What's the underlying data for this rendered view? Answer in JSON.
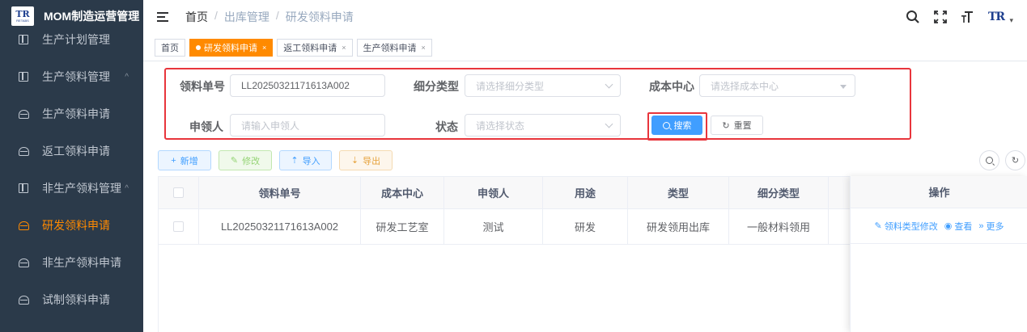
{
  "app": {
    "title": "MOM制造运营管理",
    "logo_text": "TR",
    "logo_sub": "RETABS"
  },
  "sidebar": {
    "items": [
      {
        "label": "生产计划管理",
        "icon": "grid-icon",
        "active": false,
        "expandable": false
      },
      {
        "label": "生产领料管理",
        "icon": "grid-icon",
        "active": false,
        "expandable": true,
        "arrow": "^"
      },
      {
        "label": "生产领料申请",
        "icon": "helmet-icon",
        "active": false,
        "expandable": false
      },
      {
        "label": "返工领料申请",
        "icon": "helmet-icon",
        "active": false,
        "expandable": false
      },
      {
        "label": "非生产领料管理",
        "icon": "grid-icon",
        "active": false,
        "expandable": true,
        "arrow": "^"
      },
      {
        "label": "研发领料申请",
        "icon": "helmet-icon",
        "active": true,
        "expandable": false
      },
      {
        "label": "非生产领料申请",
        "icon": "helmet-icon",
        "active": false,
        "expandable": false
      },
      {
        "label": "试制领料申请",
        "icon": "helmet-icon",
        "active": false,
        "expandable": false
      }
    ]
  },
  "breadcrumb": {
    "home": "首页",
    "level1": "出库管理",
    "current": "研发领料申请",
    "sep": "/"
  },
  "header": {
    "logo_text": "TR"
  },
  "tags": [
    {
      "label": "首页",
      "active": false,
      "closable": false
    },
    {
      "label": "研发领料申请",
      "active": true,
      "closable": true
    },
    {
      "label": "返工领料申请",
      "active": false,
      "closable": true
    },
    {
      "label": "生产领料申请",
      "active": false,
      "closable": true
    }
  ],
  "tag_close": "×",
  "search": {
    "order_no_label": "领料单号",
    "order_no_value": "LL20250321171613A002",
    "subtype_label": "细分类型",
    "subtype_placeholder": "请选择细分类型",
    "cost_center_label": "成本中心",
    "cost_center_placeholder": "请选择成本中心",
    "applicant_label": "申领人",
    "applicant_placeholder": "请输入申领人",
    "status_label": "状态",
    "status_placeholder": "请选择状态",
    "search_btn": "搜索",
    "reset_btn": "重置"
  },
  "toolbar": {
    "add": "新增",
    "edit": "修改",
    "import": "导入",
    "export": "导出"
  },
  "table": {
    "columns": [
      "领料单号",
      "成本中心",
      "申领人",
      "用途",
      "类型",
      "细分类型"
    ],
    "op_header": "操作",
    "rows": [
      {
        "order_no": "LL20250321171613A002",
        "cost_center": "研发工艺室",
        "applicant": "测试",
        "purpose": "研发",
        "type": "研发领用出库",
        "subtype": "一般材料领用"
      }
    ],
    "ops": {
      "modify_type": "领料类型修改",
      "view": "查看",
      "more": "更多"
    }
  },
  "colors": {
    "sidebar_bg": "#2b3a4a",
    "accent": "#ff8a00",
    "primary": "#409eff",
    "highlight_border": "#e8353c"
  }
}
